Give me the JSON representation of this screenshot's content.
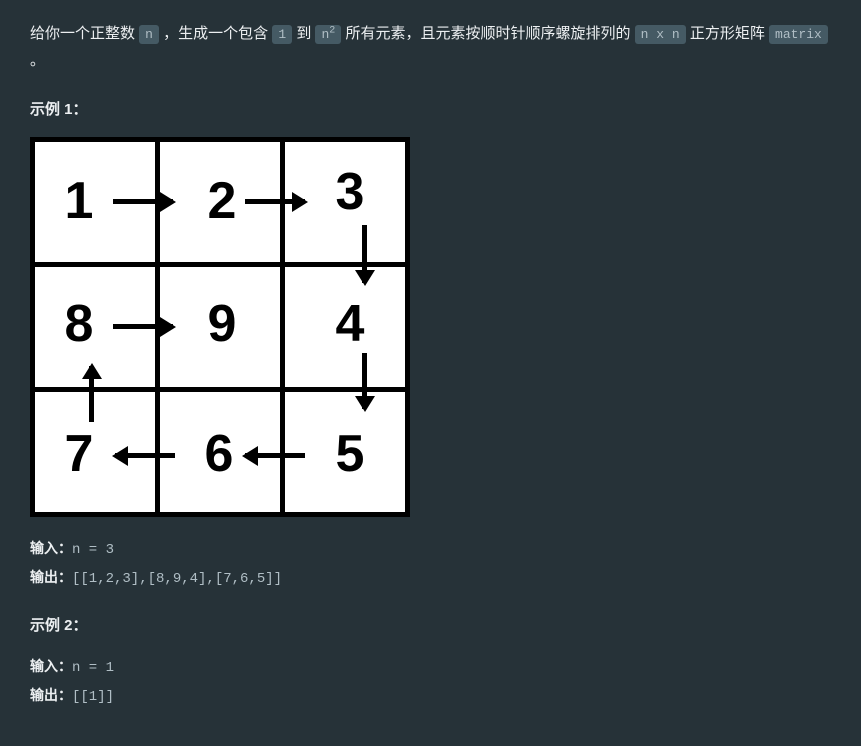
{
  "description": {
    "part1": "给你一个正整数 ",
    "code1": "n",
    "part2": " ，生成一个包含 ",
    "code2": "1",
    "part3": " 到 ",
    "code3_prefix": "n",
    "code3_sup": "2",
    "part4": " 所有元素，且元素按顺时针顺序螺旋排列的 ",
    "code4": "n x n",
    "part5": " 正方形矩阵 ",
    "code5": "matrix",
    "part6": " 。"
  },
  "example1_title": "示例 1：",
  "spiral": {
    "cells": [
      "1",
      "2",
      "3",
      "4",
      "5",
      "6",
      "7",
      "8",
      "9"
    ]
  },
  "io1": {
    "input_label": "输入：",
    "input_value": "n = 3",
    "output_label": "输出：",
    "output_value": "[[1,2,3],[8,9,4],[7,6,5]]"
  },
  "example2_title": "示例 2：",
  "io2": {
    "input_label": "输入：",
    "input_value": "n = 1",
    "output_label": "输出：",
    "output_value": "[[1]]"
  }
}
